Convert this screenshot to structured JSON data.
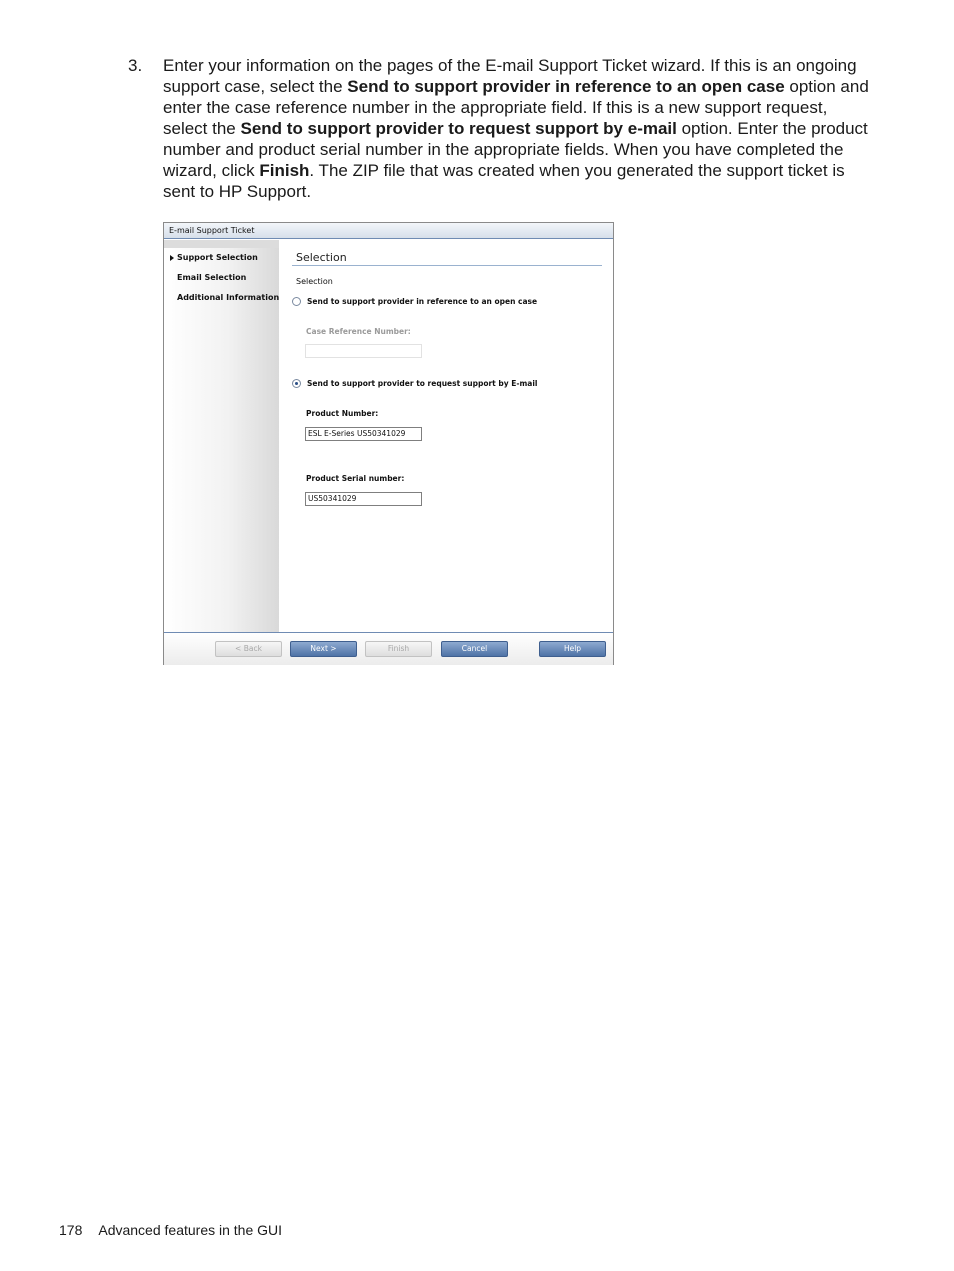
{
  "step": {
    "number": "3.",
    "parts": [
      "Enter your information on the pages of the E-mail Support Ticket wizard. If this is an ongoing support case, select the ",
      "Send to support provider in reference to an open case",
      " option and enter the case reference number in the appropriate field. If this is a new support request, select the ",
      "Send to support provider to request support by e-mail",
      " option. Enter the product number and product serial number in the appropriate fields. When you have completed the wizard, click ",
      "Finish",
      ". The ZIP file that was created when you generated the support ticket is sent to HP Support."
    ]
  },
  "dialog": {
    "title": "E-mail Support Ticket",
    "sidebar": {
      "items": [
        {
          "label": "Support Selection",
          "active": true
        },
        {
          "label": "Email Selection",
          "active": false
        },
        {
          "label": "Additional Information",
          "active": false
        }
      ]
    },
    "content": {
      "title": "Selection",
      "sub_label": "Selection",
      "option_open_case": {
        "label": "Send to support provider in reference to an open case",
        "selected": false
      },
      "case_reference": {
        "label": "Case Reference Number:",
        "value": "",
        "enabled": false
      },
      "option_email": {
        "label": "Send to support provider to request support by E-mail",
        "selected": true
      },
      "product_number": {
        "label": "Product Number:",
        "value": "ESL E-Series US50341029"
      },
      "serial_number": {
        "label": "Product Serial number:",
        "value": "US50341029"
      }
    },
    "buttons": {
      "back": "< Back",
      "next": "Next >",
      "finish": "Finish",
      "cancel": "Cancel",
      "help": "Help"
    }
  },
  "footer": {
    "page_number": "178",
    "section": "Advanced features in the GUI"
  }
}
